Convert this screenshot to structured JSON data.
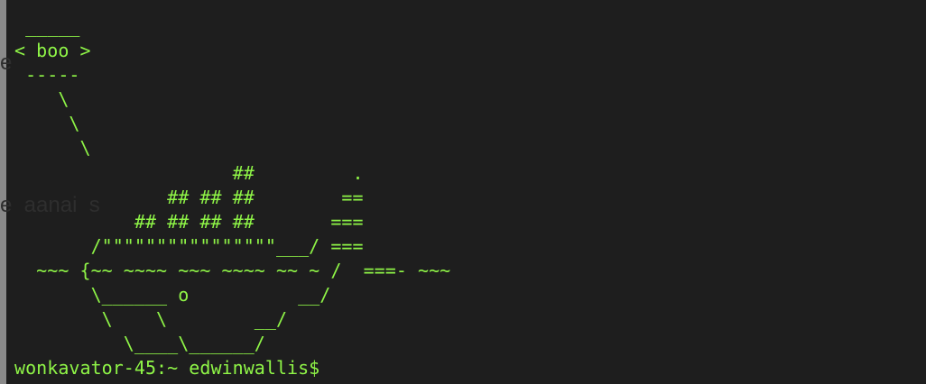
{
  "terminal": {
    "text_color": "#8ff547",
    "background_color": "#1e1e1e",
    "background_fragments": [
      "e",
      "e  aanai  s"
    ],
    "ascii_art": [
      " _____",
      "< boo >",
      " -----",
      "    \\",
      "     \\",
      "      \\",
      "                    ##         .",
      "              ## ## ##        ==",
      "           ## ## ## ##       ===",
      "       /\"\"\"\"\"\"\"\"\"\"\"\"\"\"\"\"___/ ===",
      "  ~~~ {~~ ~~~~ ~~~ ~~~~ ~~ ~ /  ===- ~~~",
      "       \\______ o          __/",
      "        \\    \\        __/",
      "          \\____\\______/"
    ],
    "prompt": "wonkavator-45:~ edwinwallis$"
  }
}
